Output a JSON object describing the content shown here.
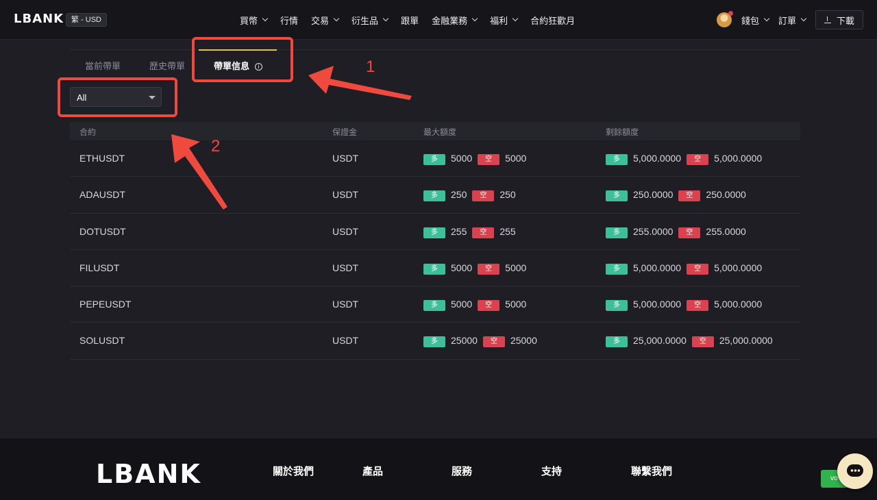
{
  "header": {
    "logo": "LBANK",
    "locale": "繁 - USD",
    "nav": [
      {
        "label": "買幣",
        "dropdown": true
      },
      {
        "label": "行情",
        "dropdown": false
      },
      {
        "label": "交易",
        "dropdown": true
      },
      {
        "label": "衍生品",
        "dropdown": true
      },
      {
        "label": "跟單",
        "dropdown": false
      },
      {
        "label": "金融業務",
        "dropdown": true
      },
      {
        "label": "福利",
        "dropdown": true
      },
      {
        "label": "合約狂歡月",
        "dropdown": false
      }
    ],
    "wallet": "錢包",
    "orders": "訂單",
    "download": "下載"
  },
  "tabs": [
    {
      "label": "當前帶單",
      "active": false
    },
    {
      "label": "歷史帶單",
      "active": false
    },
    {
      "label": "帶單信息",
      "active": true
    }
  ],
  "filter": {
    "value": "All"
  },
  "table": {
    "headers": [
      "合約",
      "保證金",
      "最大額度",
      "剩餘額度"
    ],
    "long_tag": "多",
    "short_tag": "空",
    "rows": [
      {
        "contract": "ETHUSDT",
        "margin": "USDT",
        "max_long": "5000",
        "max_short": "5000",
        "rem_long": "5,000.0000",
        "rem_short": "5,000.0000"
      },
      {
        "contract": "ADAUSDT",
        "margin": "USDT",
        "max_long": "250",
        "max_short": "250",
        "rem_long": "250.0000",
        "rem_short": "250.0000"
      },
      {
        "contract": "DOTUSDT",
        "margin": "USDT",
        "max_long": "255",
        "max_short": "255",
        "rem_long": "255.0000",
        "rem_short": "255.0000"
      },
      {
        "contract": "FILUSDT",
        "margin": "USDT",
        "max_long": "5000",
        "max_short": "5000",
        "rem_long": "5,000.0000",
        "rem_short": "5,000.0000"
      },
      {
        "contract": "PEPEUSDT",
        "margin": "USDT",
        "max_long": "5000",
        "max_short": "5000",
        "rem_long": "5,000.0000",
        "rem_short": "5,000.0000"
      },
      {
        "contract": "SOLUSDT",
        "margin": "USDT",
        "max_long": "25000",
        "max_short": "25000",
        "rem_long": "25,000.0000",
        "rem_short": "25,000.0000"
      }
    ]
  },
  "annotations": {
    "one": "1",
    "two": "2",
    "color": "#f04a3e"
  },
  "footer": {
    "logo": "LBANK",
    "columns": [
      "關於我們",
      "產品",
      "服務",
      "支持",
      "聯繫我們"
    ],
    "vote": "vo"
  },
  "colors": {
    "accent": "#e6c34a",
    "long": "#3dbf98",
    "short": "#d9434f"
  }
}
